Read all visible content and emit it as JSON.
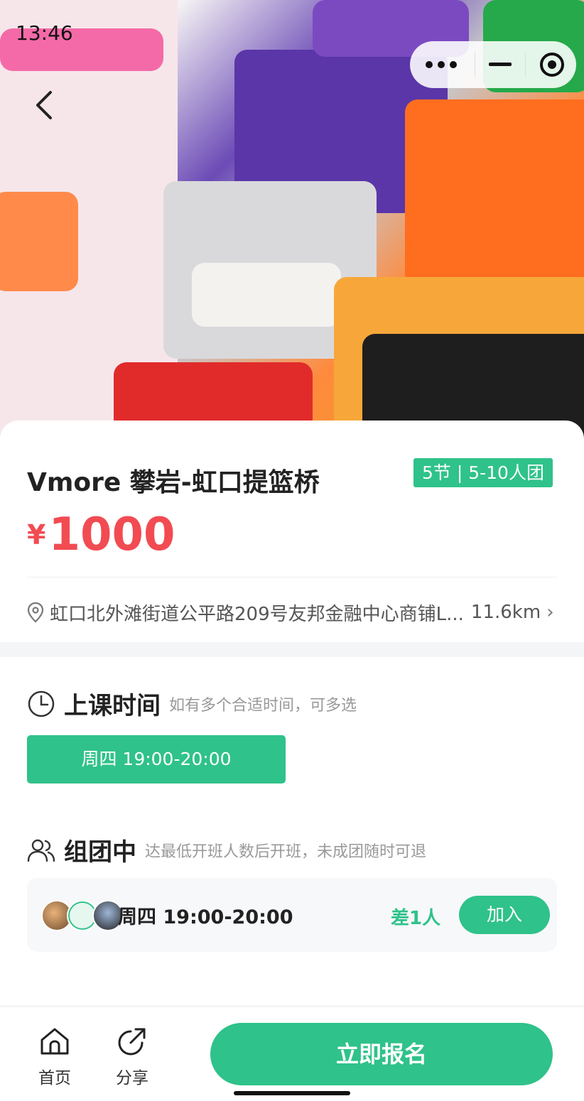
{
  "status": {
    "time": "13:46"
  },
  "product": {
    "title": "Vmore 攀岩-虹口提篮桥",
    "tag": "5节 | 5-10人团",
    "currency": "¥",
    "price": "1000",
    "address": "虹口北外滩街道公平路209号友邦金融中心商铺L...",
    "distance": "11.6km",
    "arrow": "›"
  },
  "schedule": {
    "title": "上课时间",
    "subtitle": "如有多个合适时间，可多选",
    "option": "周四 19:00-20:00"
  },
  "group": {
    "title": "组团中",
    "subtitle": "达最低开班人数后开班，未成团随时可退",
    "time": "周四 19:00-20:00",
    "need": "差1人",
    "join": "加入"
  },
  "footer": {
    "home": "首页",
    "share": "分享",
    "signup": "立即报名"
  },
  "colors": {
    "accent": "#2fc28a",
    "price": "#f24b52"
  }
}
